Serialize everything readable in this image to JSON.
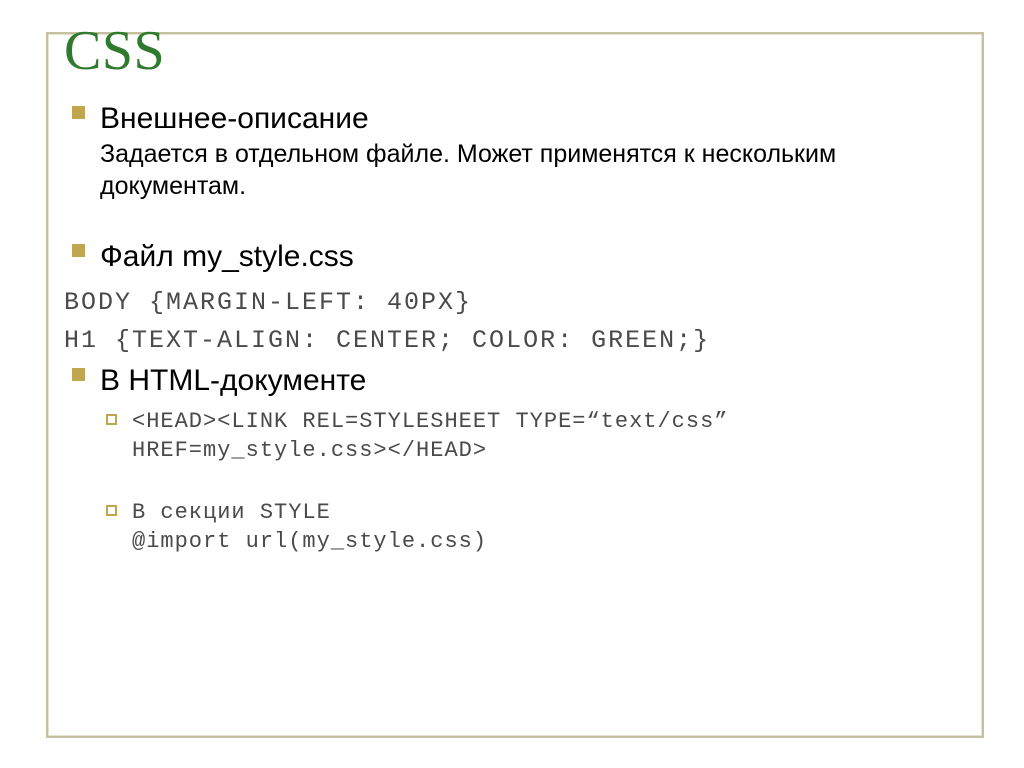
{
  "title": "CSS",
  "items": [
    {
      "heading": "Внешнее-описание",
      "desc": "Задается в отдельном файле. Может применятся к нескольким документам."
    },
    {
      "heading": "Файл my_style.css",
      "code": [
        "BODY {MARGIN-LEFT: 40PX}",
        "H1 {TEXT-ALIGN: CENTER; COLOR: GREEN;}"
      ]
    },
    {
      "heading": "В HTML-документе",
      "sub": [
        {
          "code": "<HEAD><LINK REL=STYLESHEET TYPE=“text/css” HREF=my_style.css></HEAD>"
        },
        {
          "code": "В секции STYLE\n@import url(my_style.css)"
        }
      ]
    }
  ]
}
